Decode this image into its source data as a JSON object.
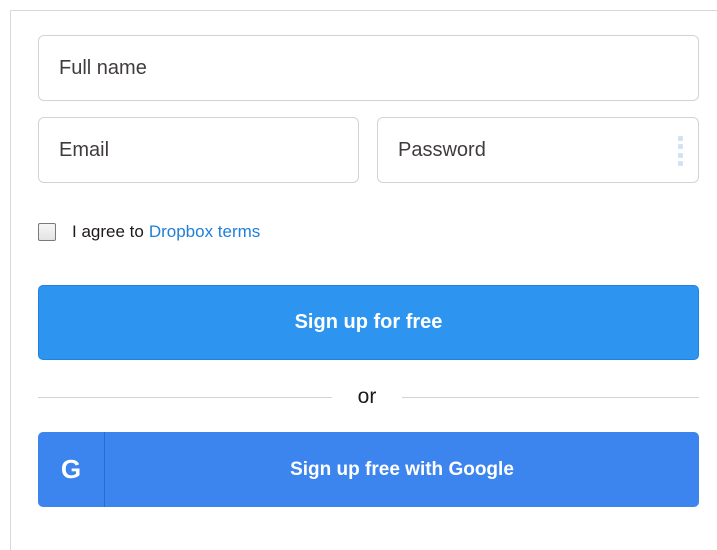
{
  "form": {
    "full_name": {
      "value": "",
      "placeholder": "Full name"
    },
    "email": {
      "value": "",
      "placeholder": "Email"
    },
    "password": {
      "value": "",
      "placeholder": "Password"
    },
    "terms": {
      "checked": false,
      "prefix": "I agree to",
      "link_label": "Dropbox terms"
    },
    "signup_button": "Sign up for free",
    "divider_text": "or",
    "google_button": {
      "icon_letter": "G",
      "label": "Sign up free with Google"
    }
  },
  "colors": {
    "primary_button": "#2d95f0",
    "google_button": "#3c84ee",
    "link": "#1f7fd8",
    "field_border": "#d0d4d9",
    "text": "#1e1919"
  },
  "icons": {
    "password_manager": "password-manager-icon",
    "google": "google-g-icon"
  }
}
